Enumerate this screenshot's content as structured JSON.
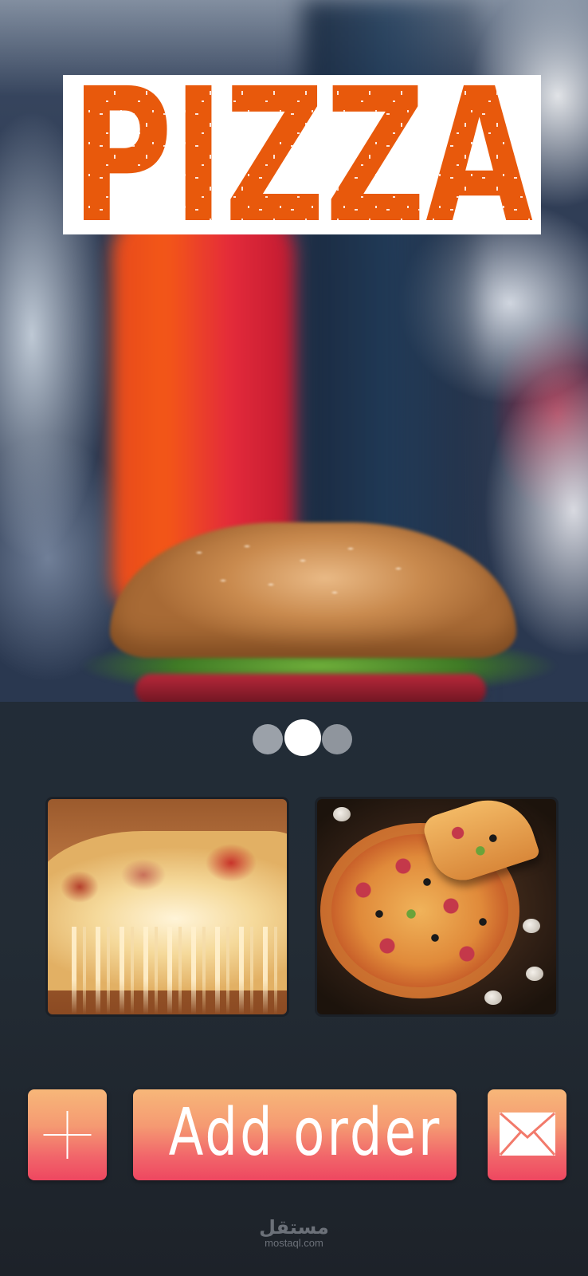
{
  "hero": {
    "logo_text": "PIZZA",
    "logo_color": "#e8590c",
    "background_image": "blurred-burger-photo"
  },
  "carousel": {
    "dot_count": 3,
    "active_index": 1
  },
  "gallery": {
    "items": [
      {
        "image": "cheesy-pizza-slice-photo"
      },
      {
        "image": "whole-pizza-photo"
      }
    ]
  },
  "actions": {
    "add_icon": "plus-icon",
    "order_label": "Add order",
    "mail_icon": "envelope-icon",
    "gradient_top": "#f7b779",
    "gradient_bottom": "#ee4760"
  },
  "watermark": {
    "arabic": "مستقل",
    "latin": "mostaql.com"
  }
}
